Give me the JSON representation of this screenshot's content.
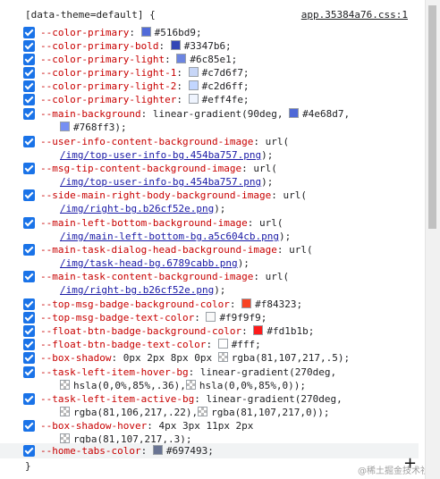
{
  "selector": "[data-theme=default] {",
  "source": "app.35384a76.css:1",
  "closing_brace": "}",
  "watermark": "@稀土掘金技术社区",
  "declarations": [
    {
      "prop": "--color-primary",
      "value": "#516bd9;",
      "swatch": "#516bd9"
    },
    {
      "prop": "--color-primary-bold",
      "value": "#3347b6;",
      "swatch": "#3347b6"
    },
    {
      "prop": "--color-primary-light",
      "value": "#6c85e1;",
      "swatch": "#6c85e1"
    },
    {
      "prop": "--color-primary-light-1",
      "value": "#c7d6f7;",
      "swatch": "#c7d6f7"
    },
    {
      "prop": "--color-primary-light-2",
      "value": "#c2d6ff;",
      "swatch": "#c2d6ff"
    },
    {
      "prop": "--color-primary-lighter",
      "value": "#eff4fe;",
      "swatch": "#eff4fe"
    },
    {
      "prop": "--main-background",
      "value_a": "linear-gradient(90deg, ",
      "swatch_a": "#4e68d7",
      "value_b": "#4e68d7,",
      "swatch_b": "#768ff3",
      "value_c": "#768ff3);"
    },
    {
      "prop": "--user-info-content-background-image",
      "value_pre": "url(",
      "url": "/img/top-user-info-bg.454ba757.png",
      "value_post": ");"
    },
    {
      "prop": "--msg-tip-content-background-image",
      "value_pre": "url(",
      "url": "/img/top-user-info-bg.454ba757.png",
      "value_post": ");"
    },
    {
      "prop": "--side-main-right-body-background-image",
      "value_pre": "url(",
      "url": "/img/right-bg.b26cf52e.png",
      "value_post": ");"
    },
    {
      "prop": "--main-left-bottom-background-image",
      "value_pre": "url(",
      "url": "/img/main-left-bottom-bg.a5c604cb.png",
      "value_post": ");"
    },
    {
      "prop": "--main-task-dialog-head-background-image",
      "value_pre": "url(",
      "url": "/img/task-head-bg.6789cabb.png",
      "value_post": ");"
    },
    {
      "prop": "--main-task-content-background-image",
      "value_pre": "url(",
      "url": "/img/right-bg.b26cf52e.png",
      "value_post": ");"
    },
    {
      "prop": "--top-msg-badge-background-color",
      "value": "#f84323;",
      "swatch": "#f84323"
    },
    {
      "prop": "--top-msg-badge-text-color",
      "value": "#f9f9f9;",
      "swatch": "#f9f9f9"
    },
    {
      "prop": "--float-btn-badge-background-color",
      "value": "#fd1b1b;",
      "swatch": "#fd1b1b"
    },
    {
      "prop": "--float-btn-badge-text-color",
      "value": "#fff;",
      "swatch": "#ffffff"
    },
    {
      "prop": "--box-shadow",
      "value_a": "0px 2px 8px 0px ",
      "value_b": "rgba(81,107,217,.5);",
      "swatch_b": "rgba(81,107,217,.5)"
    },
    {
      "prop": "--task-left-item-hover-bg",
      "value_a": "linear-gradient(270deg,",
      "value_b": "hsla(0,0%,85%,.36),",
      "value_c": "hsla(0,0%,85%,0));"
    },
    {
      "prop": "--task-left-item-active-bg",
      "value_a": "linear-gradient(270deg,",
      "value_b": "rgba(81,106,217,.22),",
      "value_c": "rgba(81,107,217,0));"
    },
    {
      "prop": "--box-shadow-hover",
      "value_a": "4px 3px 11px 2px",
      "value_b": "rgba(81,107,217,.3);"
    },
    {
      "prop": "--home-tabs-color",
      "value": "#697493;",
      "swatch": "#697493"
    }
  ]
}
